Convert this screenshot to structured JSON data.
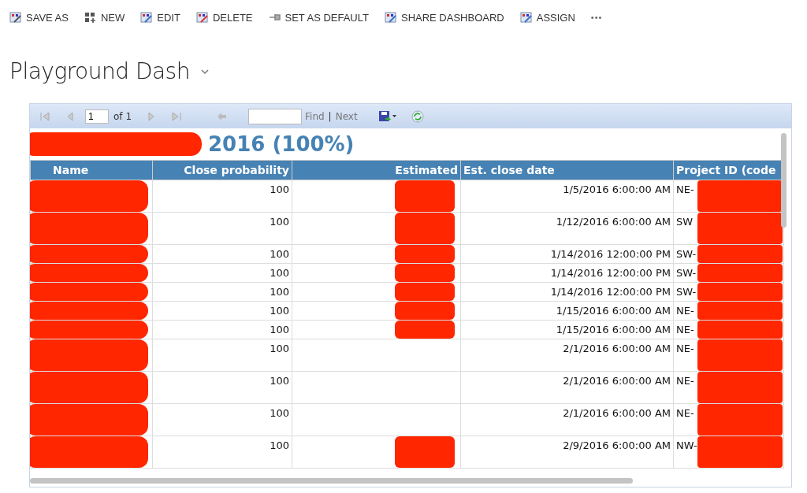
{
  "command_bar": {
    "buttons": [
      {
        "label": "SAVE AS"
      },
      {
        "label": "NEW"
      },
      {
        "label": "EDIT"
      },
      {
        "label": "DELETE"
      },
      {
        "label": "SET AS DEFAULT"
      },
      {
        "label": "SHARE DASHBOARD"
      },
      {
        "label": "ASSIGN"
      }
    ],
    "more": "•••"
  },
  "dashboard": {
    "title": "Playground Dash"
  },
  "report": {
    "toolbar": {
      "page": "1",
      "of": "of 1",
      "find": "Find",
      "separator": "|",
      "next": "Next"
    },
    "heading": "2016 (100%)",
    "table": {
      "columns": [
        "Name",
        "Close probability",
        "Estimated",
        "Est. close date",
        "Project ID (code"
      ],
      "rows": [
        {
          "close_probability": "100",
          "est_close_date": "1/5/2016 6:00:00 AM",
          "project_id": "NE-",
          "tall": true,
          "estimated_redacted": true
        },
        {
          "close_probability": "100",
          "est_close_date": "1/12/2016 6:00:00 AM",
          "project_id": "SW",
          "tall": true,
          "estimated_redacted": true
        },
        {
          "close_probability": "100",
          "est_close_date": "1/14/2016 12:00:00 PM",
          "project_id": "SW-",
          "tall": false,
          "estimated_redacted": true
        },
        {
          "close_probability": "100",
          "est_close_date": "1/14/2016 12:00:00 PM",
          "project_id": "SW-",
          "tall": false,
          "estimated_redacted": true
        },
        {
          "close_probability": "100",
          "est_close_date": "1/14/2016 12:00:00 PM",
          "project_id": "SW-",
          "tall": false,
          "estimated_redacted": true
        },
        {
          "close_probability": "100",
          "est_close_date": "1/15/2016 6:00:00 AM",
          "project_id": "NE-",
          "tall": false,
          "estimated_redacted": true
        },
        {
          "close_probability": "100",
          "est_close_date": "1/15/2016 6:00:00 AM",
          "project_id": "NE-",
          "tall": false,
          "estimated_redacted": true
        },
        {
          "close_probability": "100",
          "est_close_date": "2/1/2016 6:00:00 AM",
          "project_id": "NE-",
          "tall": true,
          "estimated_redacted": false
        },
        {
          "close_probability": "100",
          "est_close_date": "2/1/2016 6:00:00 AM",
          "project_id": "NE-",
          "tall": true,
          "estimated_redacted": false
        },
        {
          "close_probability": "100",
          "est_close_date": "2/1/2016 6:00:00 AM",
          "project_id": "NE-",
          "tall": true,
          "estimated_redacted": false
        },
        {
          "close_probability": "100",
          "est_close_date": "2/9/2016 6:00:00 AM",
          "project_id": "NW-",
          "tall": true,
          "estimated_redacted": true
        }
      ]
    }
  }
}
